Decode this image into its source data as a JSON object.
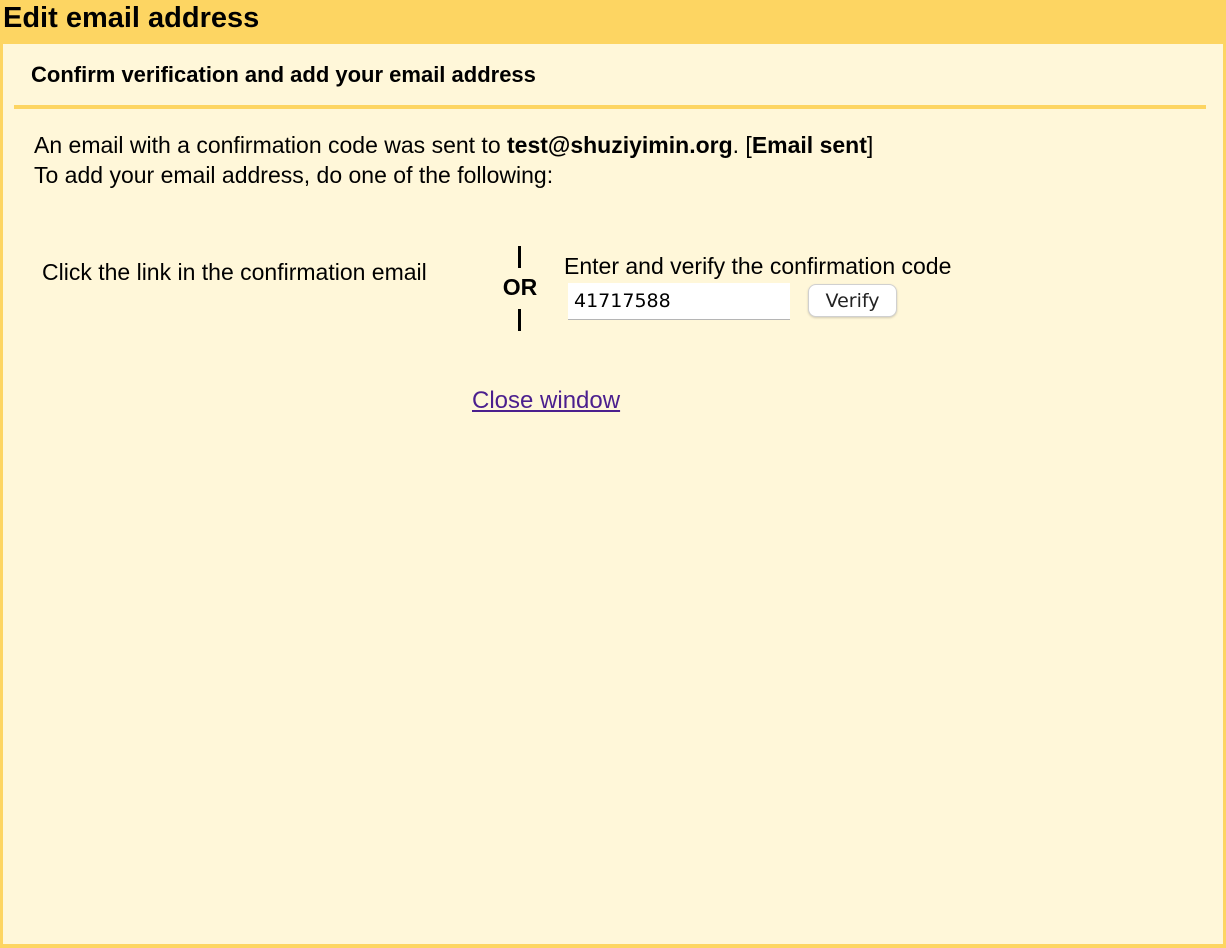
{
  "window": {
    "title": "Edit email address"
  },
  "section": {
    "heading": "Confirm verification and add your email address"
  },
  "message": {
    "line1_prefix": "An email with a confirmation code was sent to ",
    "email": "test@shuziyimin.org",
    "line1_mid": ". [",
    "status": "Email sent",
    "line1_suffix": "]",
    "line2": "To add your email address, do one of the following:"
  },
  "options": {
    "left_text": "Click the link in the confirmation email",
    "separator": "OR",
    "right_label": "Enter and verify the confirmation code",
    "code_value": "41717588",
    "verify_label": "Verify"
  },
  "footer": {
    "close_label": "Close window"
  },
  "colors": {
    "title_bar": "#fdd562",
    "background": "#fff7d9",
    "link": "#4b1f8e"
  }
}
